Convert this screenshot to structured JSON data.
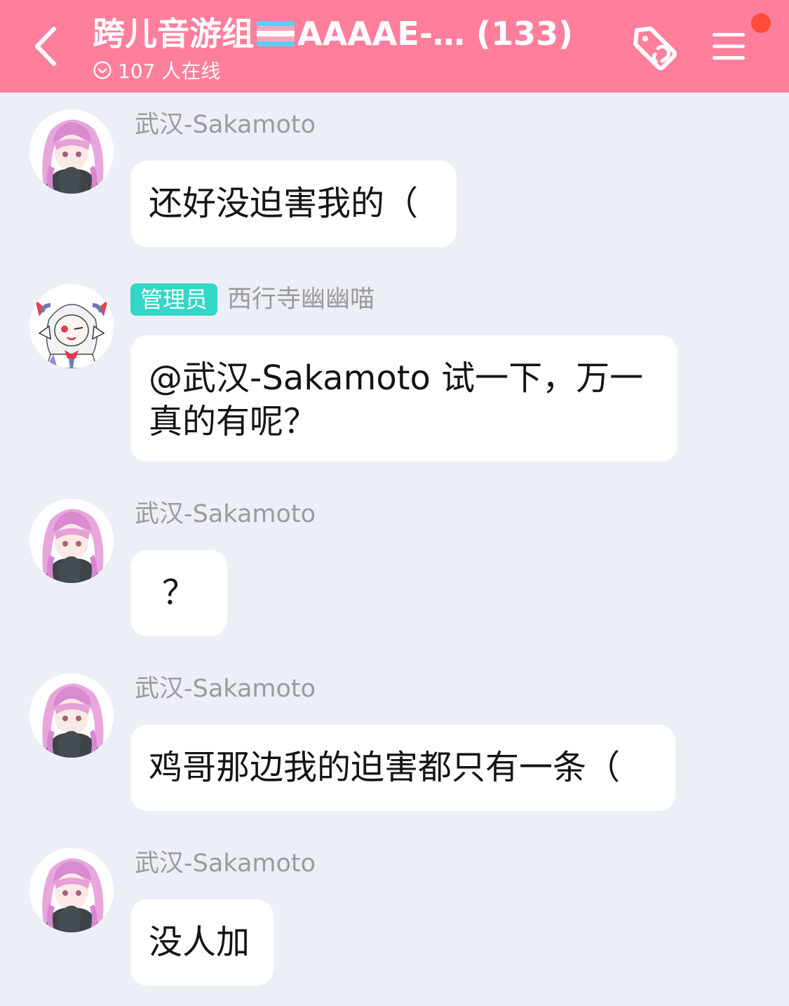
{
  "header": {
    "back_icon": "chevron-left-icon",
    "title_prefix": "跨儿音游组",
    "title_flag_icon": "transgender-flag-icon",
    "title_suffix": "AAAAE-… (133)",
    "online_icon": "check-circle-icon",
    "online_text": "107 人在线",
    "tag_icon": "tag-link-icon",
    "menu_icon": "hamburger-menu-icon",
    "bg_color": "#ff7e9c",
    "notification_dot_color": "#ff4d3a"
  },
  "messages": [
    {
      "sender": "武汉-Sakamoto",
      "role": "",
      "avatar": "pink-hair-avatar",
      "text": "还好没迫害我的（"
    },
    {
      "sender": "西行寺幽幽喵",
      "role": "管理员",
      "avatar": "white-hair-avatar",
      "text_line1": "@武汉-Sakamoto 试一下，万一",
      "text_line2": "真的有呢？"
    },
    {
      "sender": "武汉-Sakamoto",
      "role": "",
      "avatar": "pink-hair-avatar",
      "text": "？"
    },
    {
      "sender": "武汉-Sakamoto",
      "role": "",
      "avatar": "pink-hair-avatar",
      "text": "鸡哥那边我的迫害都只有一条（"
    },
    {
      "sender": "武汉-Sakamoto",
      "role": "",
      "avatar": "pink-hair-avatar",
      "text": "没人加"
    }
  ],
  "colors": {
    "chat_bg": "#eceff6",
    "bubble_bg": "#ffffff",
    "admin_badge": "#34d6c6"
  }
}
